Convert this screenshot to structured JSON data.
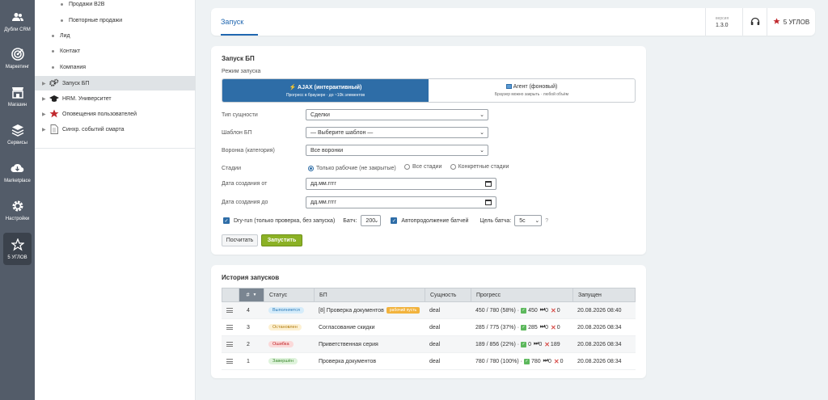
{
  "rail": [
    {
      "label": "Дубли CRM",
      "icon": "duplicates-icon"
    },
    {
      "label": "Маркетинг",
      "icon": "target-icon"
    },
    {
      "label": "Магазин",
      "icon": "shop-icon"
    },
    {
      "label": "Сервисы",
      "icon": "layers-icon"
    },
    {
      "label": "Marketplace",
      "icon": "cloud-download-icon"
    },
    {
      "label": "Настройки",
      "icon": "gear-icon"
    },
    {
      "label": "5 УГЛОВ",
      "icon": "star-icon"
    }
  ],
  "tree": {
    "items": [
      {
        "label": "Продажи B2B"
      },
      {
        "label": "Повторные продажи"
      },
      {
        "label": "Лид"
      },
      {
        "label": "Контакт"
      },
      {
        "label": "Компания"
      },
      {
        "label": "Запуск БП"
      },
      {
        "label": "HRM. Университет"
      },
      {
        "label": "Оповещения пользователей"
      },
      {
        "label": "Синхр. событий смарта"
      }
    ]
  },
  "header": {
    "tab": "Запуск",
    "version_label": "версия",
    "version": "1.3.0",
    "brand": "5 УГЛОВ"
  },
  "launch": {
    "title": "Запуск БП",
    "mode_label": "Режим запуска",
    "mode_ajax_title": "AJAX (интерактивный)",
    "mode_ajax_sub": "Прогресс в браузере · до ~10k элементов",
    "mode_agent_title": "Агент (фоновый)",
    "mode_agent_sub": "Браузер можно закрыть · любой объём",
    "entity_label": "Тип сущности",
    "entity_value": "Сделки",
    "template_label": "Шаблон БП",
    "template_value": "— Выберите шаблон —",
    "funnel_label": "Воронка (категория)",
    "funnel_value": "Все воронки",
    "stages_label": "Стадии",
    "stage_opt1": "Только рабочие (не закрытые)",
    "stage_opt2": "Все стадии",
    "stage_opt3": "Конкретные стадии",
    "date_from_label": "Дата создания от",
    "date_to_label": "Дата создания до",
    "date_placeholder": "дд.мм.гггг",
    "dryrun_label": "Dry-run (только проверка, без запуска)",
    "batch_label": "Батч:",
    "batch_value": "200",
    "autocont_label": "Автопродолжение батчей",
    "target_label": "Цель батча:",
    "target_value": "5с",
    "help": "?",
    "count_btn": "Посчитать",
    "run_btn": "Запустить"
  },
  "history": {
    "title": "История запусков",
    "columns": {
      "num": "#",
      "status": "Статус",
      "bp": "БП",
      "entity": "Сущность",
      "progress": "Прогресс",
      "started": "Запущен"
    },
    "rows": [
      {
        "num": "4",
        "status": "Выполняется",
        "status_bg": "#d6ecfa",
        "status_color": "#2a7ab8",
        "bp": "[8] Проверка документов",
        "tag": "рабочий пусть",
        "entity": "deal",
        "progress": "450 / 780 (58%) ·",
        "ok": "450",
        "skip": "0",
        "err": "0",
        "started": "20.08.2026 08:40"
      },
      {
        "num": "3",
        "status": "Остановлен",
        "status_bg": "#fdf1d3",
        "status_color": "#b07a0c",
        "bp": "Согласование скидки",
        "tag": "",
        "entity": "deal",
        "progress": "285 / 775 (37%) ·",
        "ok": "285",
        "skip": "0",
        "err": "0",
        "started": "20.08.2026 08:34"
      },
      {
        "num": "2",
        "status": "Ошибка",
        "status_bg": "#fbd9d9",
        "status_color": "#c0282d",
        "bp": "Приветственная серия",
        "tag": "",
        "entity": "deal",
        "progress": "189 / 856 (22%) ·",
        "ok": "0",
        "skip": "0",
        "err": "189",
        "started": "20.08.2026 08:34"
      },
      {
        "num": "1",
        "status": "Завершён",
        "status_bg": "#dff3dc",
        "status_color": "#3c8a2e",
        "bp": "Проверка документов",
        "tag": "",
        "entity": "deal",
        "progress": "780 / 780 (100%) ·",
        "ok": "780",
        "skip": "0",
        "err": "0",
        "started": "20.08.2026 08:34"
      }
    ]
  }
}
